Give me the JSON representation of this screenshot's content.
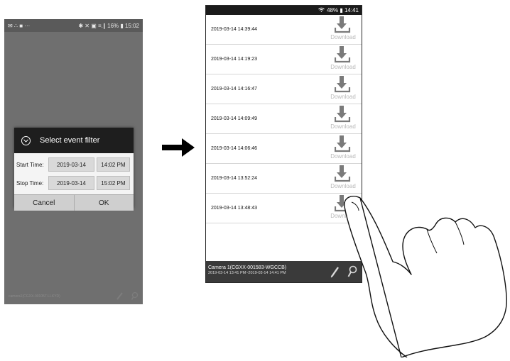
{
  "left_phone": {
    "status_bar": {
      "left_icons": "✉ ∴ ■ ···",
      "right_text": "✱ ✕ ▣ ≡.∥ 16% ▮ 15:02"
    },
    "dialog": {
      "title": "Select event filter",
      "start_label": "Start Time:",
      "start_date": "2019-03-14",
      "start_time": "14:02 PM",
      "stop_label": "Stop Time:",
      "stop_date": "2019-03-14",
      "stop_time": "15:02 PM",
      "cancel_label": "Cancel",
      "ok_label": "OK"
    },
    "footer": {
      "camera": "camera1(CGXX-001057-LLKYD)"
    },
    "background_color": "#6f6f6f"
  },
  "right_phone": {
    "status_bar": {
      "text": "48% ▮ 14:41"
    },
    "events": [
      {
        "time": "2019-03-14 14:39:44",
        "download_label": "Download"
      },
      {
        "time": "2019-03-14 14:19:23",
        "download_label": "Download"
      },
      {
        "time": "2019-03-14 14:16:47",
        "download_label": "Download"
      },
      {
        "time": "2019-03-14 14:09:49",
        "download_label": "Download"
      },
      {
        "time": "2019-03-14 14:06:46",
        "download_label": "Download"
      },
      {
        "time": "2019-03-14 13:52:24",
        "download_label": "Download"
      },
      {
        "time": "2019-03-14 13:48:43",
        "download_label": "Download"
      }
    ],
    "footer": {
      "camera": "Camera 1(CGXX-001583-WGCCB)",
      "range": "2019-03-14 13:41 PM~2019-03-14 14:41 PM"
    }
  },
  "icons": {
    "download": "download-icon",
    "pencil": "pencil-icon",
    "search": "search-icon",
    "arrow": "arrow-right-icon",
    "hand": "pointing-hand-icon"
  },
  "colors": {
    "footer_bg": "#3a3a3a",
    "download_icon": "#7a7a7a",
    "download_text": "#b9b9b9",
    "dialog_header": "#1e1e1e"
  }
}
